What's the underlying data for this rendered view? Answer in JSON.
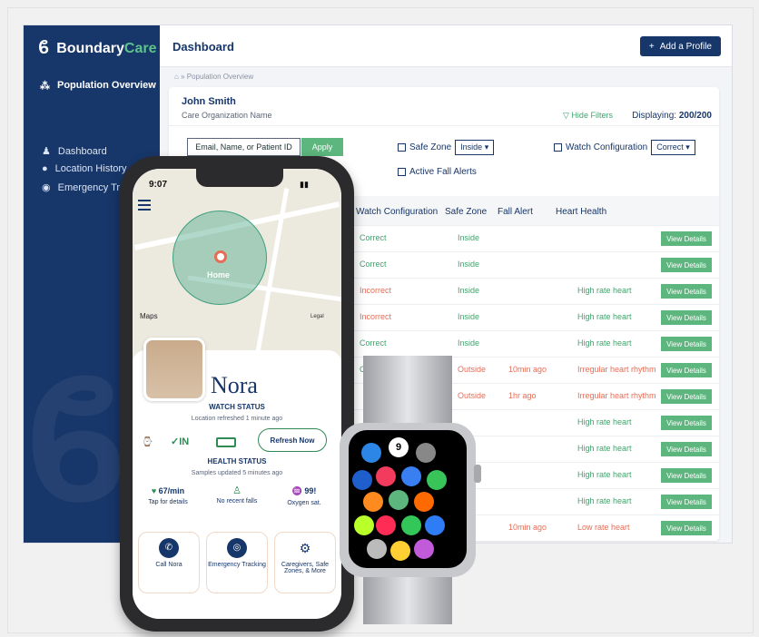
{
  "brand": {
    "name_part1": "Boundary",
    "name_part2": "Care"
  },
  "sidebar": {
    "active_item": "Population Overview",
    "items": [
      {
        "label": "Dashboard"
      },
      {
        "label": "Location History"
      },
      {
        "label": "Emergency Tracking"
      }
    ]
  },
  "header": {
    "title": "Dashboard",
    "add_button": "Add a Profile"
  },
  "breadcrumb": "» Population Overview",
  "profile": {
    "name": "John Smith",
    "org": "Care Organization Name"
  },
  "filters": {
    "hide_label": "Hide Filters",
    "displaying_label": "Displaying:",
    "displaying_value": "200/200",
    "search_placeholder": "Email, Name, or Patient ID",
    "apply": "Apply",
    "safe_zone_label": "Safe Zone",
    "safe_zone_value": "Inside",
    "watch_config_label": "Watch Configuration",
    "watch_config_value": "Correct",
    "fall_alerts_label": "Active Fall Alerts"
  },
  "table": {
    "headers": [
      "Watch Configuration",
      "Safe Zone",
      "Fall Alert",
      "Heart Health"
    ],
    "view_label": "View Details",
    "rows": [
      {
        "config": "Correct",
        "zone": "Inside",
        "fall": "",
        "heart": ""
      },
      {
        "config": "Correct",
        "zone": "Inside",
        "fall": "",
        "heart": ""
      },
      {
        "config": "Incorrect",
        "zone": "Inside",
        "fall": "",
        "heart": "High rate heart"
      },
      {
        "config": "Incorrect",
        "zone": "Inside",
        "fall": "",
        "heart": "High rate heart"
      },
      {
        "config": "Correct",
        "zone": "Inside",
        "fall": "",
        "heart": "High rate heart"
      },
      {
        "config": "Correct",
        "zone": "Outside",
        "fall": "10min ago",
        "heart": "Irregular heart rhythm"
      },
      {
        "config": "",
        "zone": "Outside",
        "fall": "1hr ago",
        "heart": "Irregular heart rhythm"
      },
      {
        "config": "",
        "zone": "",
        "fall": "",
        "heart": "High rate heart"
      },
      {
        "config": "",
        "zone": "",
        "fall": "",
        "heart": "High rate heart"
      },
      {
        "config": "",
        "zone": "",
        "fall": "",
        "heart": "High rate heart"
      },
      {
        "config": "",
        "zone": "",
        "fall": "",
        "heart": "High rate heart"
      },
      {
        "config": "",
        "zone": "",
        "fall": "10min ago",
        "heart": "Low rate heart"
      }
    ]
  },
  "phone": {
    "time": "9:07",
    "map_label": "Home",
    "maps_brand": "Maps",
    "legal": "Legal",
    "patient_name": "Nora",
    "watch_status_title": "WATCH STATUS",
    "watch_status_sub": "Location refreshed 1 minute ago",
    "in_label": "✓IN",
    "refresh_label": "Refresh Now",
    "health_status_title": "HEALTH STATUS",
    "health_status_sub": "Samples updated 5 minutes ago",
    "hr_value": "67/min",
    "hr_caption": "Tap for details",
    "falls_caption": "No recent falls",
    "oxygen_value": "99!",
    "oxygen_caption": "Oxygen sat.",
    "tiles": [
      {
        "label": "Call Nora"
      },
      {
        "label": "Emergency Tracking"
      },
      {
        "label": "Caregivers, Safe Zones, & More"
      }
    ]
  },
  "watch": {
    "date_num": "9"
  },
  "colors": {
    "navy": "#173669",
    "green": "#5cb67d",
    "red": "#e86c55"
  }
}
